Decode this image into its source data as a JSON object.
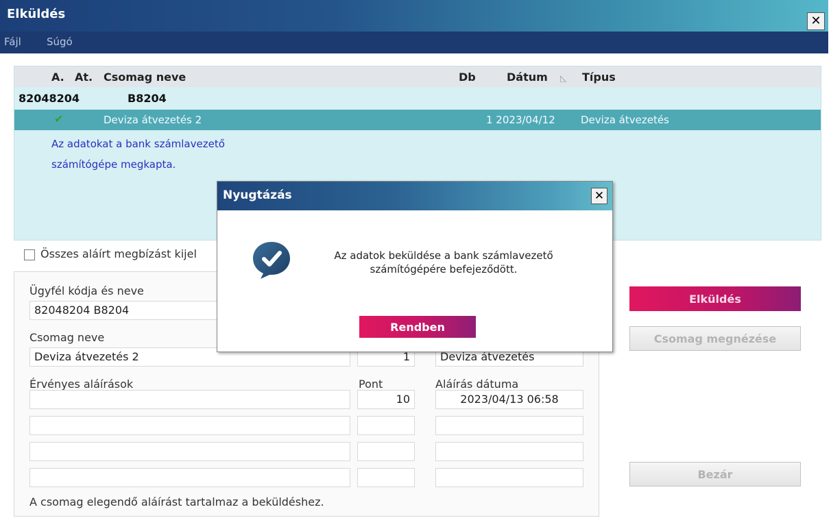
{
  "window": {
    "title": "Elküldés"
  },
  "menu": [
    {
      "label": "Fájl"
    },
    {
      "label": "Súgó"
    }
  ],
  "list": {
    "columns": {
      "a": "A.",
      "at": "At.",
      "name": "Csomag neve",
      "db": "Db",
      "date": "Dátum",
      "type": "Típus"
    },
    "sort_icon": "sort-triangle-icon",
    "group": {
      "code": "82048204",
      "name": "B8204"
    },
    "selected": {
      "status_icon": "check-icon",
      "name": "Deviza átvezetés 2",
      "db_date": "1 2023/04/12",
      "type": "Deviza átvezetés"
    },
    "info_lines": [
      "Az adatokat a bank számlavezető",
      "számítógépe megkapta."
    ]
  },
  "checkbox": {
    "label": "Összes aláírt megbízást kijel"
  },
  "form": {
    "client_label": "Ügyfél kódja és neve",
    "client_value": "82048204  B8204",
    "package_label": "Csomag neve",
    "package_value": "Deviza átvezetés 2",
    "package_count": "1",
    "package_type": "Deviza átvezetés",
    "signatures_label": "Érvényes aláírások",
    "points_label": "Pont",
    "signature_date_label": "Aláírás dátuma",
    "signatures": [
      {
        "name": "",
        "points": "10",
        "date": "2023/04/13 06:58"
      },
      {
        "name": "",
        "points": "",
        "date": ""
      },
      {
        "name": "",
        "points": "",
        "date": ""
      },
      {
        "name": "",
        "points": "",
        "date": ""
      }
    ],
    "status_text": "A csomag elegendő aláírást tartalmaz a beküldéshez."
  },
  "buttons": {
    "send": "Elküldés",
    "view": "Csomag megnézése",
    "close": "Bezár"
  },
  "dialog": {
    "title": "Nyugtázás",
    "message_line1": "Az adatok beküldése a bank számlavezető",
    "message_line2": "számítógépére befejeződött.",
    "icon": "info-check-bubble-icon",
    "ok": "Rendben"
  },
  "colors": {
    "accent_button": "#c8185f",
    "title_bar": "#1c3f78",
    "selection": "#4fa9b5"
  }
}
